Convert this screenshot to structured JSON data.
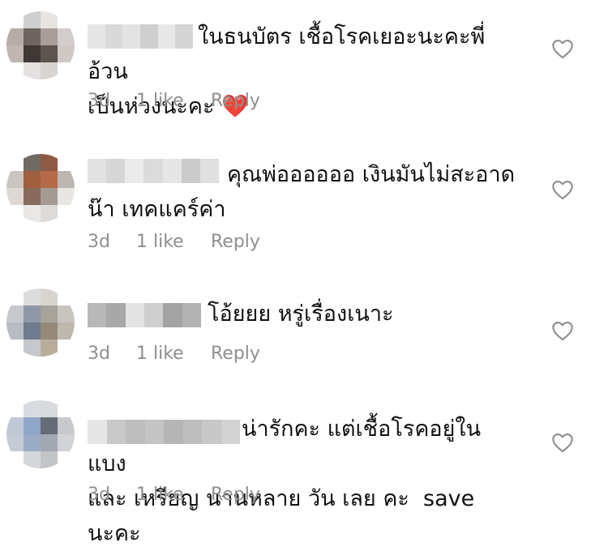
{
  "comments": [
    {
      "text": "ในธนบัตร เชื้อโรคเยอะนะคะพี่อ้วน\nเป็นห่วงนะคะ",
      "emoji": "❤️",
      "time": "3d",
      "likes": "1 like",
      "reply": "Reply",
      "like_icon": "heart-outline-icon"
    },
    {
      "text": "คุณพ่ออออออ เงินมันไม่สะอาด\nน๊า เทคแคร์ค่า",
      "time": "3d",
      "likes": "1 like",
      "reply": "Reply",
      "like_icon": "heart-outline-icon"
    },
    {
      "text": "โอ้ยยย หรู่เรื่องเนาะ",
      "time": "3d",
      "likes": "1 like",
      "reply": "Reply",
      "like_icon": "heart-outline-icon"
    },
    {
      "text": "น่ารักคะ แต่เชื้อโรคอยู่ในแบง\nและ เหรียญ นานหลาย วัน เลย คะ  save นะคะ",
      "time": "3d",
      "likes": "1 like",
      "reply": "Reply",
      "like_icon": "heart-outline-icon"
    }
  ],
  "colors": {
    "meta_text": "#8e8e8e",
    "heart_emoji": "#e0192a"
  }
}
